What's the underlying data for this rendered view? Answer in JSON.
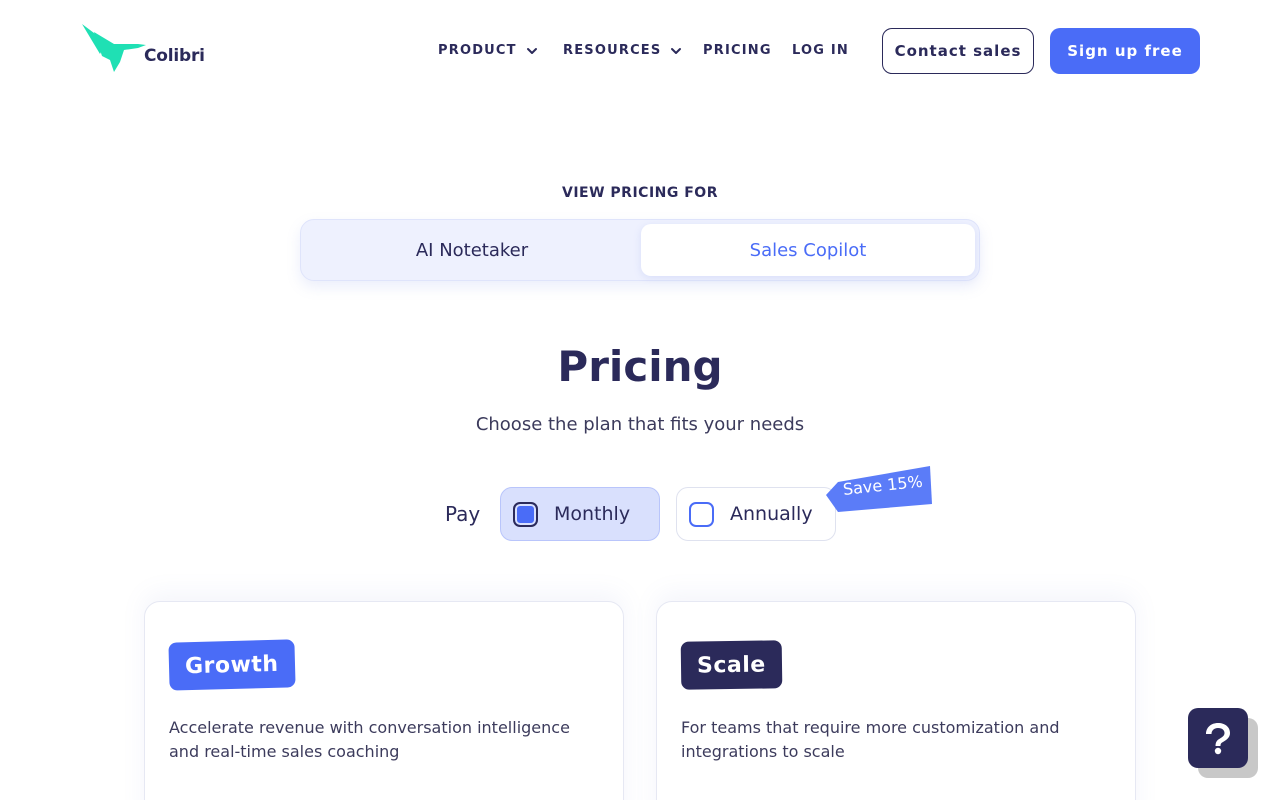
{
  "header": {
    "logo_text": "Colibri",
    "nav": [
      {
        "label": "PRODUCT",
        "has_dropdown": true
      },
      {
        "label": "RESOURCES",
        "has_dropdown": true
      },
      {
        "label": "PRICING",
        "has_dropdown": false
      },
      {
        "label": "LOG IN",
        "has_dropdown": false
      }
    ],
    "contact_label": "Contact sales",
    "signup_label": "Sign up free"
  },
  "view_pricing": {
    "label": "VIEW PRICING FOR",
    "options": [
      "AI Notetaker",
      "Sales Copilot"
    ],
    "selected": "Sales Copilot"
  },
  "hero": {
    "title": "Pricing",
    "subtitle": "Choose the plan that fits your needs"
  },
  "billing": {
    "pay_label": "Pay",
    "monthly_label": "Monthly",
    "annually_label": "Annually",
    "selected": "Monthly",
    "save_badge": "Save 15%"
  },
  "plans": [
    {
      "name": "Growth",
      "description": "Accelerate revenue with conversation intelligence and real-time sales coaching"
    },
    {
      "name": "Scale",
      "description": "For teams that require more customization and integrations to scale"
    }
  ],
  "colors": {
    "brand_navy": "#2b2a5a",
    "accent_blue": "#4a6cf7",
    "logo_green": "#1fe0b4"
  },
  "icons": {
    "logo": "hummingbird-icon",
    "dropdown": "chevron-down-icon",
    "help": "question-mark-icon"
  }
}
